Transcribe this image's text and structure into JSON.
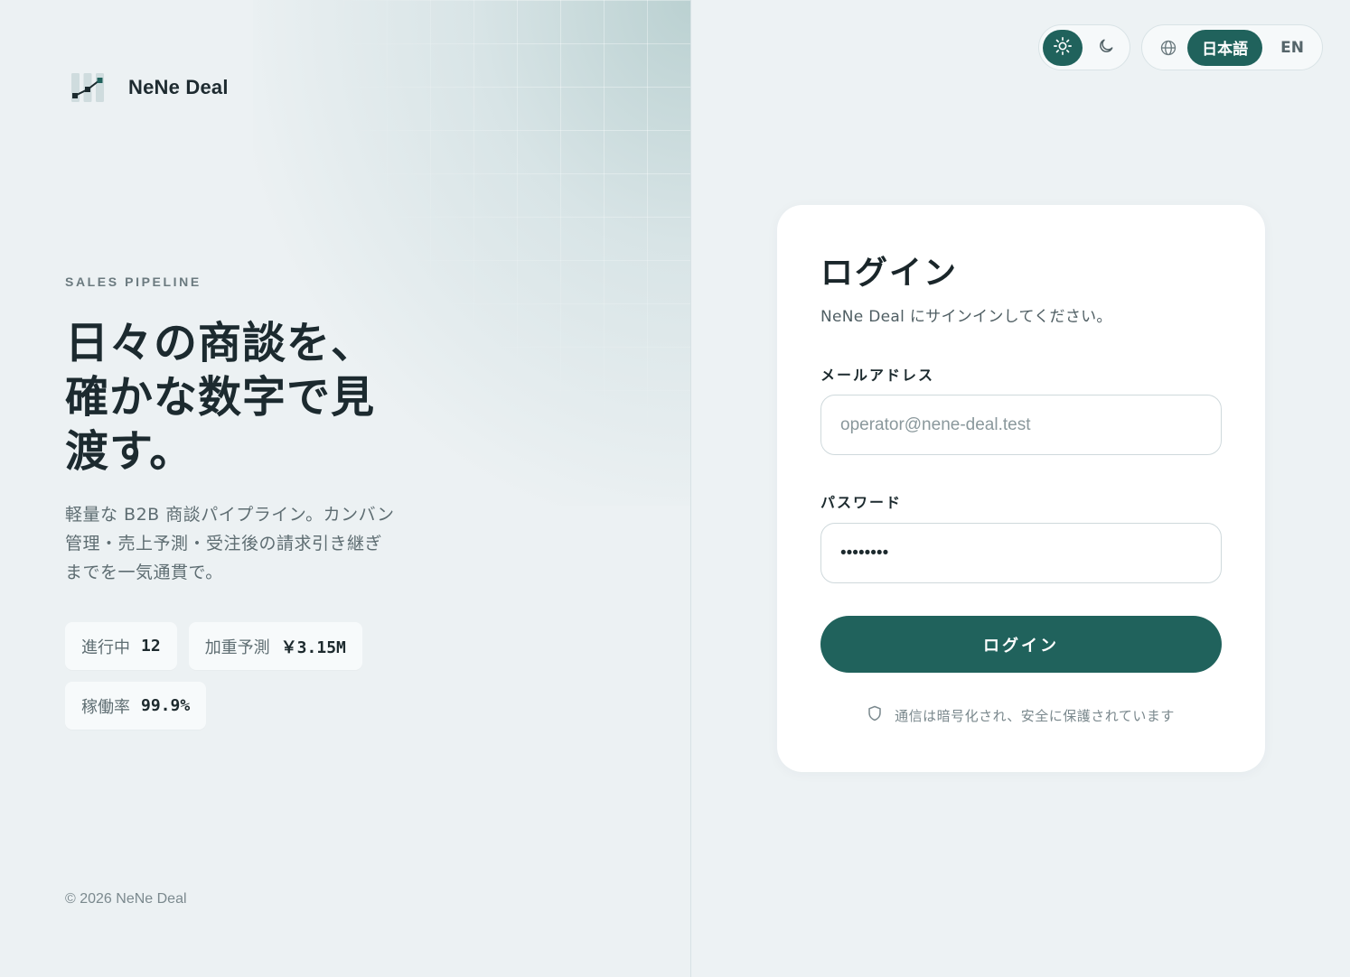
{
  "brand": {
    "name": "NeNe Deal"
  },
  "hero": {
    "eyebrow": "SALES PIPELINE",
    "headline": "日々の商談を、確かな数字で見渡す。",
    "lede": "軽量な B2B 商談パイプライン。カンバン管理・売上予測・受注後の請求引き継ぎまでを一気通貫で。",
    "stats": [
      {
        "label": "進行中",
        "value": "12"
      },
      {
        "label": "加重予測",
        "value": "￥3.15M"
      },
      {
        "label": "稼働率",
        "value": "99.9%"
      }
    ]
  },
  "footer": {
    "copyright": "© 2026 NeNe Deal"
  },
  "topbar": {
    "theme": {
      "selected": "light",
      "options": [
        "light",
        "dark"
      ],
      "icons": [
        "sun-icon",
        "moon-icon"
      ]
    },
    "language": {
      "icon": "globe-icon",
      "options": [
        "日本語",
        "EN"
      ],
      "selected": "日本語"
    }
  },
  "login": {
    "title": "ログイン",
    "subtitle": "NeNe Deal にサインインしてください。",
    "email_label": "メールアドレス",
    "email_placeholder": "operator@nene-deal.test",
    "password_label": "パスワード",
    "password_value": "••••••••",
    "submit_label": "ログイン",
    "secure_note": "通信は暗号化され、安全に保護されています",
    "secure_icon": "shield-icon"
  },
  "colors": {
    "accent": "#20625c",
    "background": "#edf2f4",
    "card": "#ffffff"
  }
}
